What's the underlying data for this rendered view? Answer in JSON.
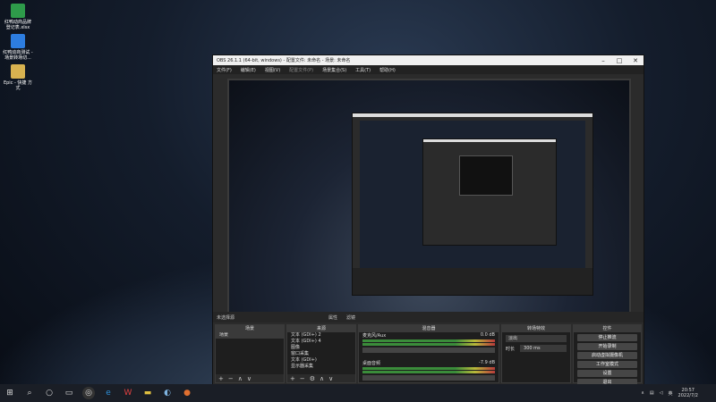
{
  "desktop": {
    "icons": [
      {
        "label": "红鸭动商品牌 登记表.xlsx",
        "color": "#2e9b4a"
      },
      {
        "label": "红鸭动商测试 -场景转场切...",
        "color": "#2d7de0"
      },
      {
        "label": "Epic - 快捷 方式",
        "color": "#d8b250"
      }
    ]
  },
  "taskbar": {
    "items": [
      "windows-logo",
      "search",
      "task-view",
      "widgets",
      "obs",
      "edge",
      "wps",
      "explorer",
      "steam",
      "firefox"
    ],
    "tray_lang": "英",
    "time": "20:57",
    "date": "2022/7/2"
  },
  "obs": {
    "title": "OBS 26.1.1 (64-bit, windows) - 配置文件: 未命名 - 场景: 未命名",
    "menu": [
      "文件(F)",
      "编辑(E)",
      "视图(V)",
      "配置文件(P)",
      "场景集合(S)",
      "工具(T)",
      "帮助(H)"
    ],
    "status": {
      "source_selected": "未选择源",
      "properties": "属性",
      "filters": "滤镜"
    },
    "docks": {
      "scenes": {
        "title": "场景",
        "items": [
          "场景"
        ]
      },
      "sources": {
        "title": "来源",
        "items": [
          "文本 (GDI+) 2",
          "文本 (GDI+) 4",
          "图像",
          "窗口采集",
          "文本 (GDI+)",
          "显示器采集"
        ]
      },
      "mixer": {
        "title": "混音器",
        "channels": [
          {
            "name": "麦克风/Aux",
            "level": "0.0 dB"
          },
          {
            "name": "桌面音频",
            "level": "-7.9 dB"
          }
        ]
      },
      "transitions": {
        "title": "转场特效",
        "type": "淡出",
        "duration_label": "时长",
        "duration_value": "300 ms"
      },
      "controls": {
        "title": "控件",
        "buttons": [
          "停止推流",
          "开始录制",
          "启动虚拟摄像机",
          "工作室模式",
          "设置",
          "退出"
        ]
      }
    }
  }
}
